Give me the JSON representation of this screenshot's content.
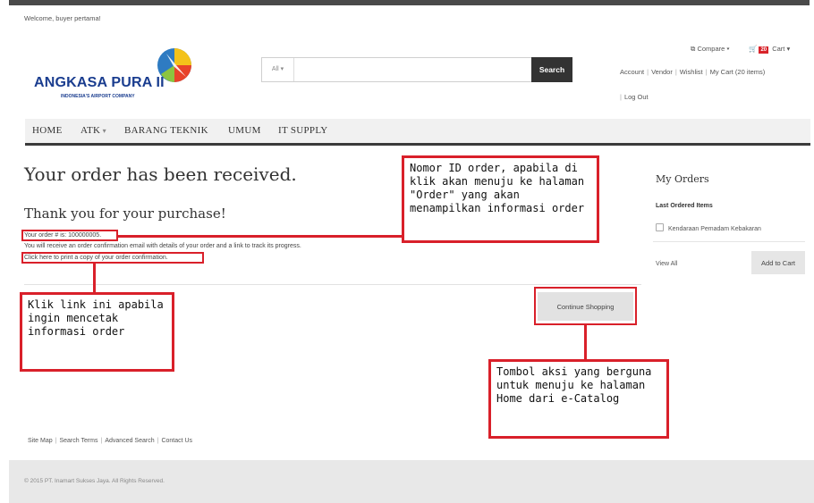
{
  "header": {
    "welcome": "Welcome, buyer pertama!",
    "logo_main": "ANGKASA PURA II",
    "logo_sub": "INDONESIA'S AIRPORT COMPANY",
    "search_category": "All",
    "search_placeholder": "",
    "search_button": "Search",
    "compare_label": "Compare",
    "cart_count": "20",
    "cart_label": "Cart",
    "links": [
      "Account",
      "Vendor",
      "Wishlist",
      "My Cart (20 items)"
    ],
    "logout": "Log Out"
  },
  "nav": {
    "items": [
      "HOME",
      "ATK",
      "BARANG TEKNIK",
      "UMUM",
      "IT SUPPLY"
    ]
  },
  "main": {
    "title": "Your order has been received.",
    "thanks": "Thank you for your purchase!",
    "order_number": "Your order # is: 100000005.",
    "email_note": "You will receive an order confirmation email with details of your order and a link to track its progress.",
    "print_link": "Click here to print a copy of your order confirmation.",
    "continue_button": "Continue Shopping"
  },
  "sidebar": {
    "title": "My Orders",
    "subtitle": "Last Ordered Items",
    "item": "Kendaraan Pemadam Kebakaran",
    "view_all": "View All",
    "add_to_cart": "Add to Cart"
  },
  "footer": {
    "links": [
      "Site Map",
      "Search Terms",
      "Advanced Search",
      "Contact Us"
    ],
    "copyright": "© 2015 PT. Inamart Sukses Jaya. All Rights Reserved."
  },
  "callouts": {
    "order_id": "Nomor ID order, apabila di klik akan menuju ke halaman \"Order\" yang akan menampilkan informasi order",
    "print": "Klik link ini apabila ingin mencetak informasi order",
    "continue": "Tombol aksi yang berguna untuk menuju ke halaman Home dari e-Catalog"
  },
  "colors": {
    "callout_border": "#d9202a",
    "search_button_bg": "#333333",
    "logo_text": "#1a3d8f",
    "cart_badge": "#d8232a"
  }
}
